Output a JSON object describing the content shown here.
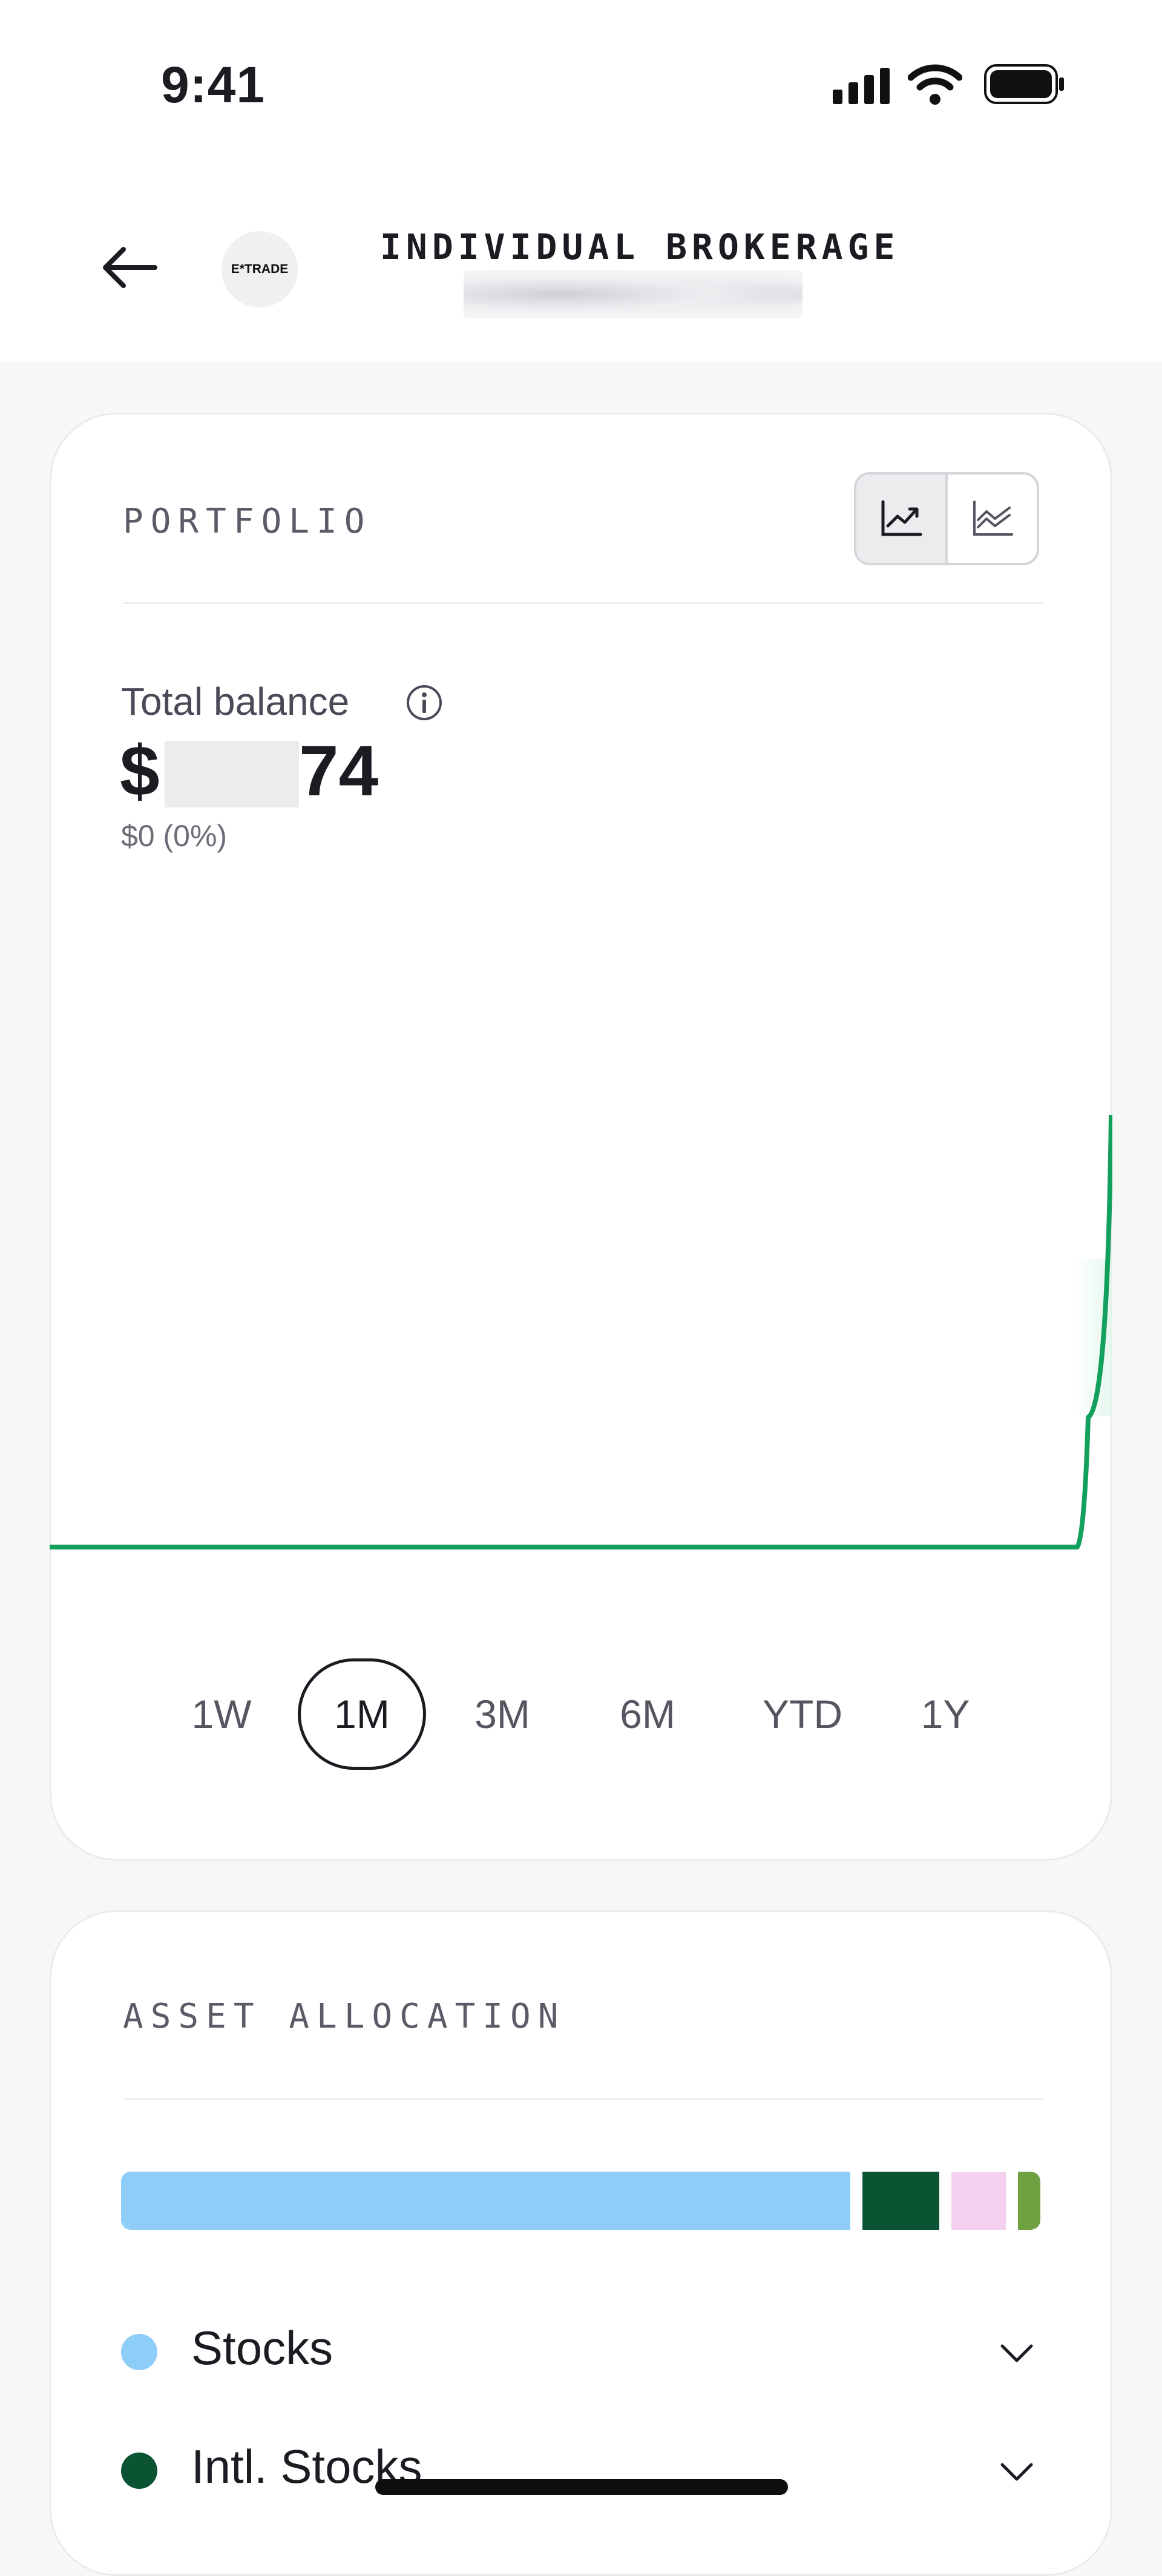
{
  "status_bar": {
    "time": "9:41"
  },
  "header": {
    "title": "INDIVIDUAL BROKERAGE",
    "logo_text": "E*TRADE"
  },
  "portfolio": {
    "label": "PORTFOLIO",
    "view_toggle": [
      "line-chart-icon",
      "area-chart-icon"
    ],
    "total_balance_label": "Total balance",
    "balance_prefix": "$",
    "balance_suffix": "74",
    "change": "$0 (0%)",
    "ranges": [
      "1W",
      "1M",
      "3M",
      "6M",
      "YTD",
      "1Y"
    ],
    "selected_range": "1M",
    "line_color": "#12a05c"
  },
  "chart_data": {
    "type": "line",
    "title": "",
    "xlabel": "",
    "ylabel": "",
    "series": [
      {
        "values": [
          0,
          0,
          0,
          0,
          0,
          0,
          0,
          0,
          0,
          0,
          0,
          0,
          0,
          0,
          0,
          0,
          0,
          0,
          0,
          0,
          0,
          0,
          0,
          0,
          0,
          0,
          0,
          0,
          0.3,
          1
        ]
      }
    ],
    "grid": false,
    "legend": "none"
  },
  "asset_allocation": {
    "label": "ASSET ALLOCATION",
    "segments": [
      {
        "name": "Stocks",
        "share": 0.805,
        "color": "#8ecdf7"
      },
      {
        "name": "Intl. Stocks",
        "share": 0.085,
        "color": "#0a5433"
      },
      {
        "name": "",
        "share": 0.06,
        "color": "#f4d1ef"
      },
      {
        "name": "",
        "share": 0.025,
        "color": "#6fa042"
      }
    ],
    "legend": [
      {
        "label": "Stocks",
        "color": "#8ecdf7"
      },
      {
        "label": "Intl. Stocks",
        "color": "#0a5433"
      }
    ]
  }
}
